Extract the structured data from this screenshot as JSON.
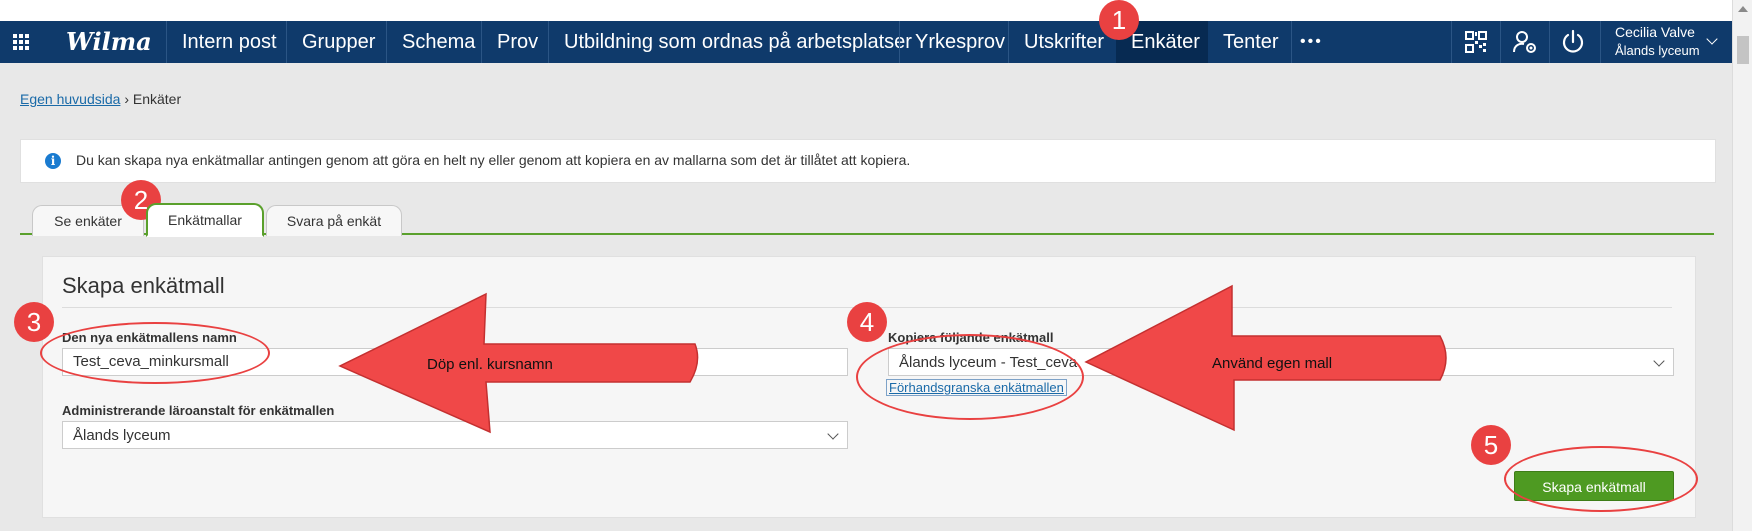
{
  "app": {
    "logo": "Wilma"
  },
  "nav": {
    "items": [
      "Intern post",
      "Grupper",
      "Schema",
      "Prov",
      "Utbildning som ordnas på arbetsplatser",
      "Yrkesprov",
      "Utskrifter",
      "Enkäter",
      "Tenter"
    ],
    "more_label": "•••",
    "active": "Enkäter",
    "user_name": "Cecilia Valve",
    "user_school": "Ålands lyceum"
  },
  "icons": [
    "grid-menu-icon",
    "qr-code-icon",
    "user-settings-icon",
    "power-icon",
    "chevron-down-icon",
    "info-icon"
  ],
  "breadcrumb": {
    "home": "Egen huvudsida",
    "separator": "›",
    "current": "Enkäter"
  },
  "info": {
    "text": "Du kan skapa nya enkätmallar antingen genom att göra en helt ny eller genom att kopiera en av mallarna som det är tillåtet att kopiera."
  },
  "tabs": [
    "Se enkäter",
    "Enkätmallar",
    "Svara på enkät"
  ],
  "form": {
    "title": "Skapa enkätmall",
    "name_label": "Den nya enkätmallens namn",
    "name_value": "Test_ceva_minkursmall",
    "admin_label": "Administrerande läroanstalt för enkätmallen",
    "admin_value": "Ålands lyceum",
    "copy_label": "Kopiera följande enkätmall",
    "copy_value": "Ålands lyceum - Test_ceva",
    "preview_link": "Förhandsgranska enkätmallen",
    "create_button": "Skapa enkätmall"
  },
  "annotations": {
    "badges": [
      "1",
      "2",
      "3",
      "4",
      "5"
    ],
    "arrow1_text": "Döp enl. kursnamn",
    "arrow2_text": "Använd egen mall",
    "color": "#e94141"
  },
  "colors": {
    "navbar": "#0f3a6b",
    "accent_green": "#5aa02c",
    "button_green": "#4e9a22",
    "link": "#1a6aa8"
  }
}
